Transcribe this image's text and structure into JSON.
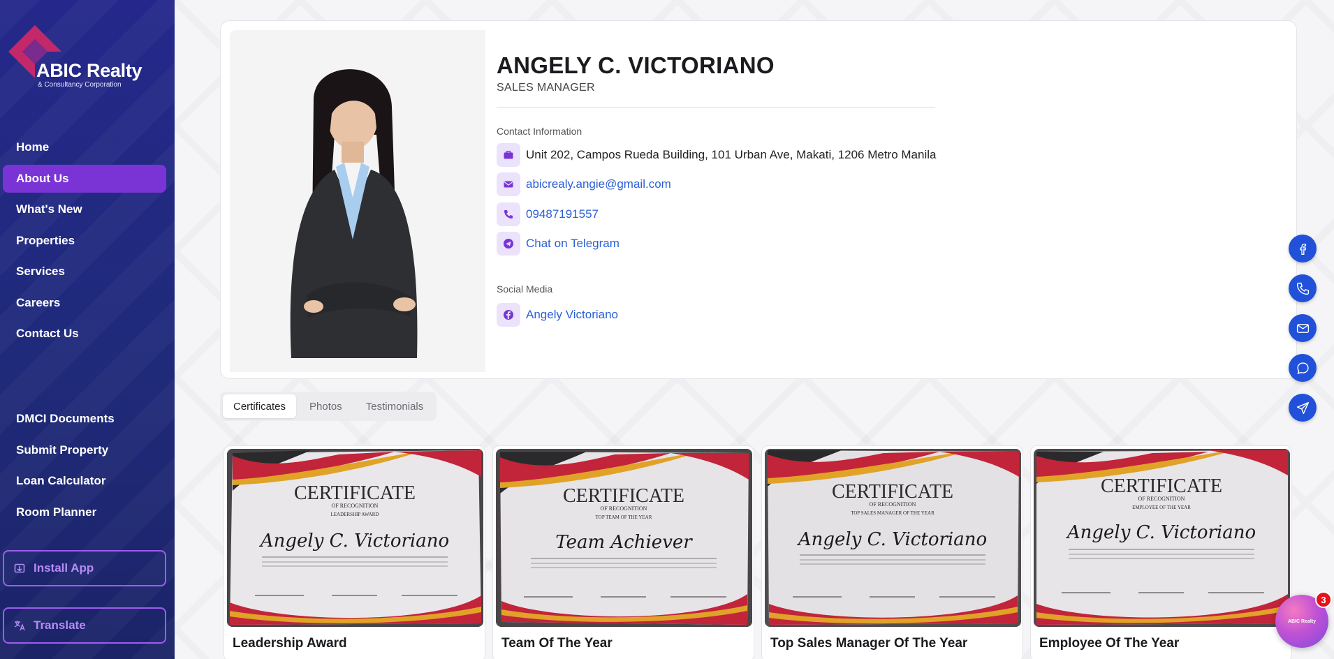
{
  "brand": {
    "name": "ABIC Realty",
    "subtitle": "& Consultancy Corporation"
  },
  "nav": {
    "primary": [
      {
        "label": "Home",
        "active": false
      },
      {
        "label": "About Us",
        "active": true
      },
      {
        "label": "What's New",
        "active": false
      },
      {
        "label": "Properties",
        "active": false
      },
      {
        "label": "Services",
        "active": false
      },
      {
        "label": "Careers",
        "active": false
      },
      {
        "label": "Contact Us",
        "active": false
      }
    ],
    "secondary": [
      {
        "label": "DMCI Documents"
      },
      {
        "label": "Submit Property"
      },
      {
        "label": "Loan Calculator"
      },
      {
        "label": "Room Planner"
      }
    ],
    "install_label": "Install App",
    "translate_label": "Translate"
  },
  "profile": {
    "name": "ANGELY C. VICTORIANO",
    "role": "SALES MANAGER",
    "contact_heading": "Contact Information",
    "address": "Unit 202, Campos Rueda Building, 101 Urban Ave, Makati, 1206 Metro Manila",
    "email": "abicrealy.angie@gmail.com",
    "phone": "09487191557",
    "telegram": "Chat on Telegram",
    "social_heading": "Social Media",
    "facebook": "Angely Victoriano"
  },
  "tabs": [
    {
      "label": "Certificates",
      "active": true
    },
    {
      "label": "Photos",
      "active": false
    },
    {
      "label": "Testimonials",
      "active": false
    }
  ],
  "certificates": [
    {
      "title": "Leadership Award",
      "heading": "CERTIFICATE",
      "subheading": "OF RECOGNITION",
      "award": "LEADERSHIP AWARD",
      "recipient": "Angely C. Victoriano"
    },
    {
      "title": "Team Of The Year",
      "heading": "CERTIFICATE",
      "subheading": "OF RECOGNITION",
      "award": "TOP TEAM OF THE YEAR",
      "recipient": "Team Achiever"
    },
    {
      "title": "Top Sales Manager Of The Year",
      "heading": "CERTIFICATE",
      "subheading": "OF RECOGNITION",
      "award": "TOP SALES MANAGER OF THE YEAR",
      "recipient": "Angely C. Victoriano"
    },
    {
      "title": "Employee Of The Year",
      "heading": "CERTIFICATE",
      "subheading": "OF RECOGNITION",
      "award": "EMPLOYEE OF THE YEAR",
      "recipient": "Angely C. Victoriano"
    }
  ],
  "floating": [
    "facebook-icon",
    "phone-icon",
    "mail-icon",
    "chat-icon",
    "send-icon"
  ],
  "chat": {
    "label": "ABIC Realty",
    "badge": "3"
  },
  "colors": {
    "sidebar": "#25288a",
    "accent": "#7a34d6",
    "link": "#2a5fd6",
    "float": "#2051d8"
  }
}
